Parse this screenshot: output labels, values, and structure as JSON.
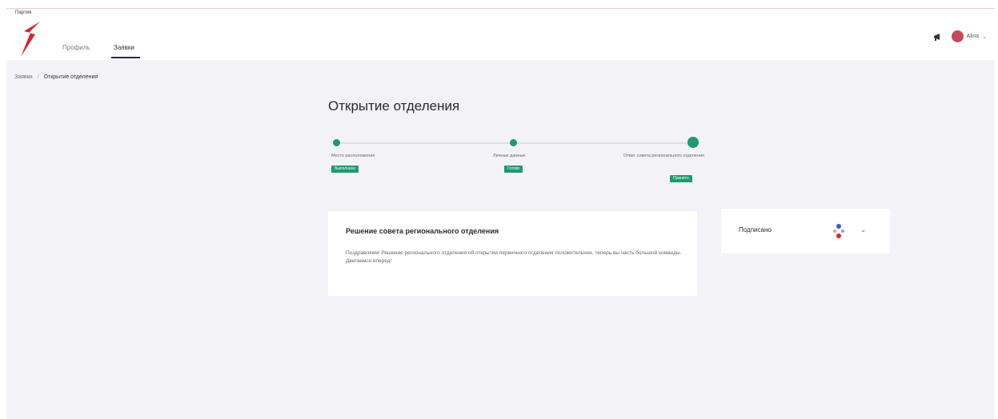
{
  "app": {
    "logo_text": "Партия"
  },
  "header": {
    "tabs": [
      {
        "label": "Профиль"
      },
      {
        "label": "Заявки"
      }
    ],
    "user": {
      "name": "Alina"
    }
  },
  "breadcrumb": {
    "items": [
      {
        "label": "Заявки"
      },
      {
        "label": "Открытие отделения"
      }
    ]
  },
  "page": {
    "title": "Открытие отделения"
  },
  "stepper": {
    "steps": [
      {
        "label": "Место расположения",
        "status": "Выполнено"
      },
      {
        "label": "Личные данные",
        "status": "Готово"
      },
      {
        "label": "Ответ совета регионального отделения",
        "status": "Принято"
      }
    ],
    "accent_color": "#1e9a6c"
  },
  "decision_card": {
    "title": "Решение совета регионального отделения",
    "text": "Поздравляем! Решение регионального отделения об открытии первичного отделения положительное, теперь вы часть большой команды. Двигаемся вперед!"
  },
  "signature_card": {
    "label": "Подписано"
  }
}
